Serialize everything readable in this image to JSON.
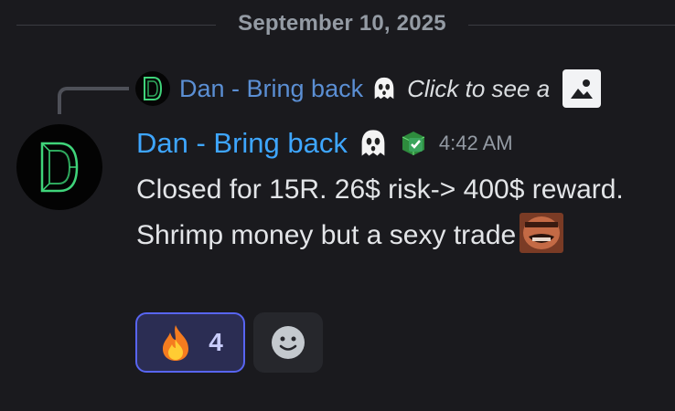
{
  "divider": {
    "date": "September 10, 2025"
  },
  "reply": {
    "username": "Dan - Bring back",
    "ghost_icon": "ghost-emoji",
    "preview_text": "Click to see a",
    "attachment_icon": "image-icon"
  },
  "message": {
    "username": "Dan - Bring back",
    "username_color": "#3ea6ff",
    "ghost_icon": "ghost-emoji",
    "badge_icon": "green-checkmark-badge",
    "timestamp": "4:42 AM",
    "text": "Closed for 15R. 26$ risk-> 400$ reward. Shrimp money but a sexy trade",
    "inline_emoji": "laughing-face-custom-emoji"
  },
  "reactions": [
    {
      "emoji": "fire-emoji",
      "count": "4",
      "selected": true
    }
  ],
  "add_reaction_icon": "smiley-face-icon",
  "colors": {
    "background": "#1a1a1e",
    "reaction_selected_bg": "#2b2d53",
    "reaction_selected_border": "#5865f2",
    "reply_name": "#5b8fd4"
  }
}
